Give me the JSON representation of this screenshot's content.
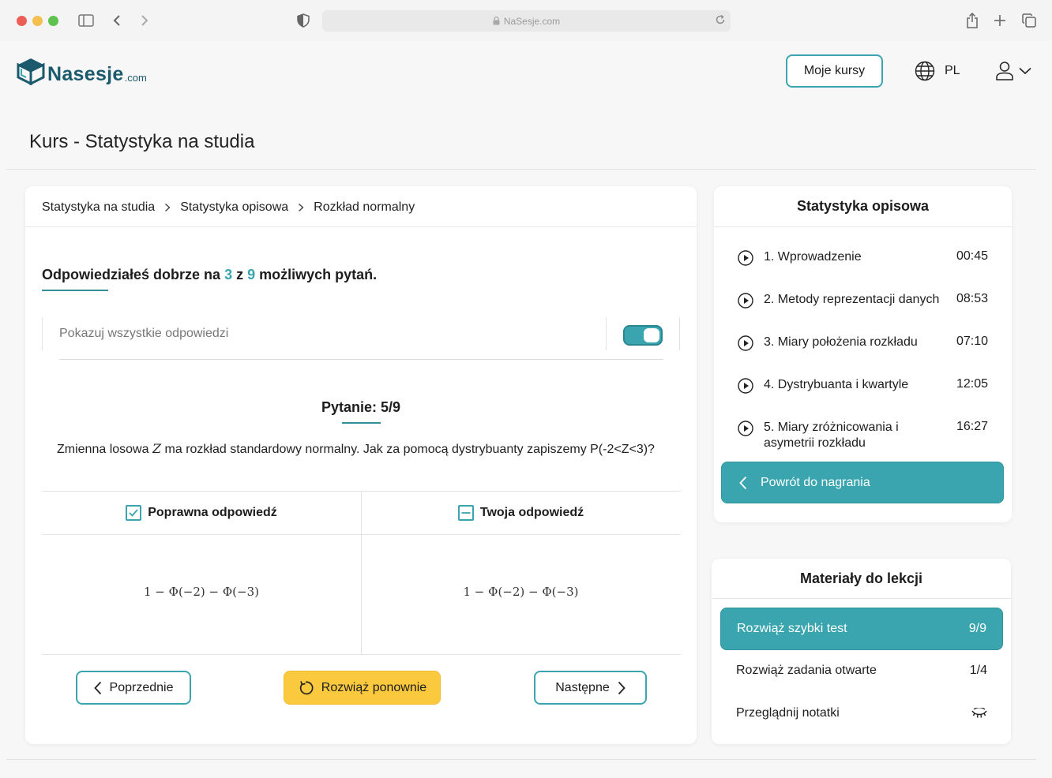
{
  "browser": {
    "url": "NaSesje.com",
    "colors": {
      "close": "#ec5f57",
      "minimize": "#f5bf4f",
      "maximize": "#5ec34e"
    }
  },
  "header": {
    "logo_text": "Nasesje",
    "logo_suffix": ".com",
    "my_courses": "Moje kursy",
    "language": "PL"
  },
  "page_title": "Kurs - Statystyka na studia",
  "breadcrumb": [
    "Statystyka na studia",
    "Statystyka opisowa",
    "Rozkład normalny"
  ],
  "result": {
    "prefix": "Odpowiedziałeś dobrze na",
    "correct": "3",
    "middle": "z",
    "total": "9",
    "suffix": "możliwych pytań."
  },
  "show_all": {
    "label": "Pokazuj wszystkie odpowiedzi",
    "enabled": true
  },
  "question": {
    "title": "Pytanie: 5/9",
    "text_before": "Zmienna losowa",
    "variable": "Z",
    "text_after": "ma rozkład standardowy normalny. Jak za pomocą dystrybuanty zapiszemy P(-2<Z<3)?"
  },
  "answers": {
    "correct_label": "Poprawna odpowiedź",
    "correct_formula": "1 − Φ(−2) − Φ(−3)",
    "yours_label": "Twoja odpowiedź",
    "yours_formula": "1 − Φ(−2) − Φ(−3)"
  },
  "nav": {
    "prev": "Poprzednie",
    "retry": "Rozwiąż ponownie",
    "next": "Następne"
  },
  "lessons": {
    "title": "Statystyka opisowa",
    "items": [
      {
        "name": "1. Wprowadzenie",
        "time": "00:45"
      },
      {
        "name": "2. Metody reprezentacji danych",
        "time": "08:53"
      },
      {
        "name": "3. Miary położenia rozkładu",
        "time": "07:10"
      },
      {
        "name": "4. Dystrybuanta i kwartyle",
        "time": "12:05"
      },
      {
        "name": "5. Miary zróżnicowania i asymetrii rozkładu",
        "time": "16:27"
      }
    ],
    "back_button": "Powrót do nagrania"
  },
  "materials": {
    "title": "Materiały do lekcji",
    "items": [
      {
        "label": "Rozwiąż szybki test",
        "value": "9/9"
      },
      {
        "label": "Rozwiąż zadania otwarte",
        "value": "1/4"
      },
      {
        "label": "Przeglądnij notatki",
        "icon": "eye-closed-icon"
      }
    ]
  },
  "colors": {
    "accent": "#3aa5ae",
    "accent_dark": "#1b5a6c",
    "retry": "#fbc93e"
  }
}
